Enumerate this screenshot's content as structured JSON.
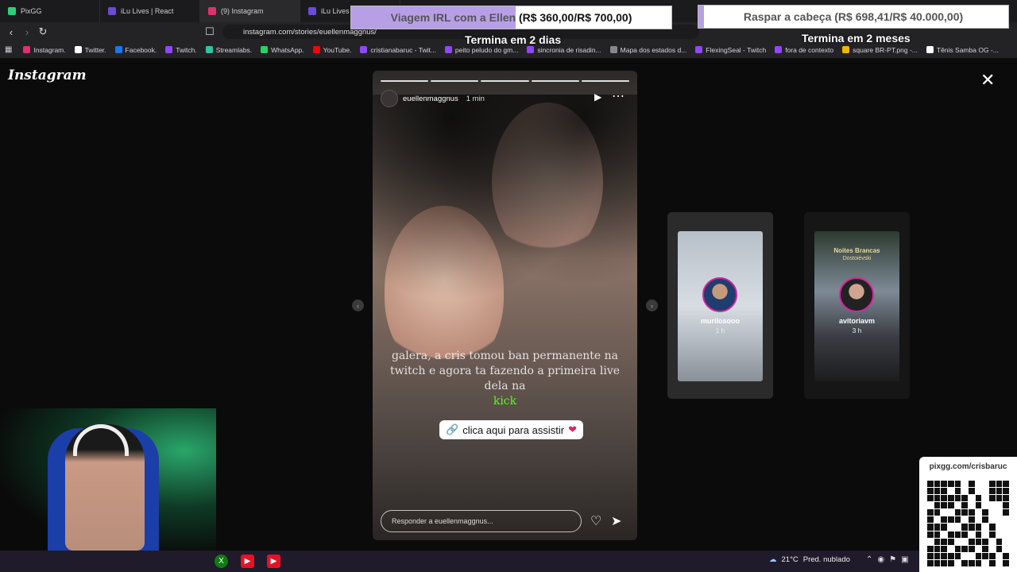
{
  "tabs": [
    {
      "label": "PixGG",
      "color": "#2ad17a"
    },
    {
      "label": "iLu Lives | React",
      "color": "#6b4bd8"
    },
    {
      "label": "(9) Instagram",
      "color": "#e1306c"
    },
    {
      "label": "iLu Lives |",
      "color": "#6b4bd8"
    }
  ],
  "address": {
    "url": "instagram.com/stories/euellenmaggnus/"
  },
  "bookmarks": [
    {
      "label": "Instagram.",
      "color": "#e1306c"
    },
    {
      "label": "Twitter.",
      "color": "#ffffff"
    },
    {
      "label": "Facebook.",
      "color": "#1877f2"
    },
    {
      "label": "Twitch.",
      "color": "#9146ff"
    },
    {
      "label": "Streamlabs.",
      "color": "#31c3a2"
    },
    {
      "label": "WhatsApp.",
      "color": "#25d366"
    },
    {
      "label": "YouTube.",
      "color": "#ff0000"
    },
    {
      "label": "cristianabaruc - Twit...",
      "color": "#9146ff"
    },
    {
      "label": "peito peludo do gm...",
      "color": "#9146ff"
    },
    {
      "label": "sincronia de risadin...",
      "color": "#9146ff"
    },
    {
      "label": "Mapa dos estados d...",
      "color": "#888888"
    },
    {
      "label": "FlexingSeal - Twitch",
      "color": "#9146ff"
    },
    {
      "label": "fora de contexto",
      "color": "#9146ff"
    },
    {
      "label": "square BR-PT.png -...",
      "color": "#f4b400"
    },
    {
      "label": "Tênis Samba OG -...",
      "color": "#ffffff"
    }
  ],
  "instagram": {
    "logo": "Instagram"
  },
  "story": {
    "username": "euellenmaggnus",
    "time": "1 min",
    "text_main": "galera, a cris tomou ban permanente na twitch e agora ta fazendo a primeira live dela na",
    "text_kick": "kick",
    "link_sticker": "clica aqui para assistir",
    "reply_placeholder": "Responder a euellenmaggnus..."
  },
  "previews": [
    {
      "name": "murilosooo",
      "time": "1 h"
    },
    {
      "name": "avitoriavm",
      "time": "3 h",
      "book_title": "Noites Brancas",
      "book_author": "Dostoiévski"
    }
  ],
  "goals": [
    {
      "title": "Viagem IRL com a Ellen",
      "amount": "(R$ 360,00/R$ 700,00)",
      "progress": 0.514,
      "subtitle": "Termina em 2 dias"
    },
    {
      "title": "Raspar a cabeça",
      "amount": "(R$ 698,41/R$ 40.000,00)",
      "progress": 0.017,
      "subtitle": "Termina em 2 meses"
    }
  ],
  "taskbar": {
    "temperature": "21°C",
    "weather": "Pred. nublado"
  },
  "qr": {
    "url": "pixgg.com/crisbaruc"
  }
}
